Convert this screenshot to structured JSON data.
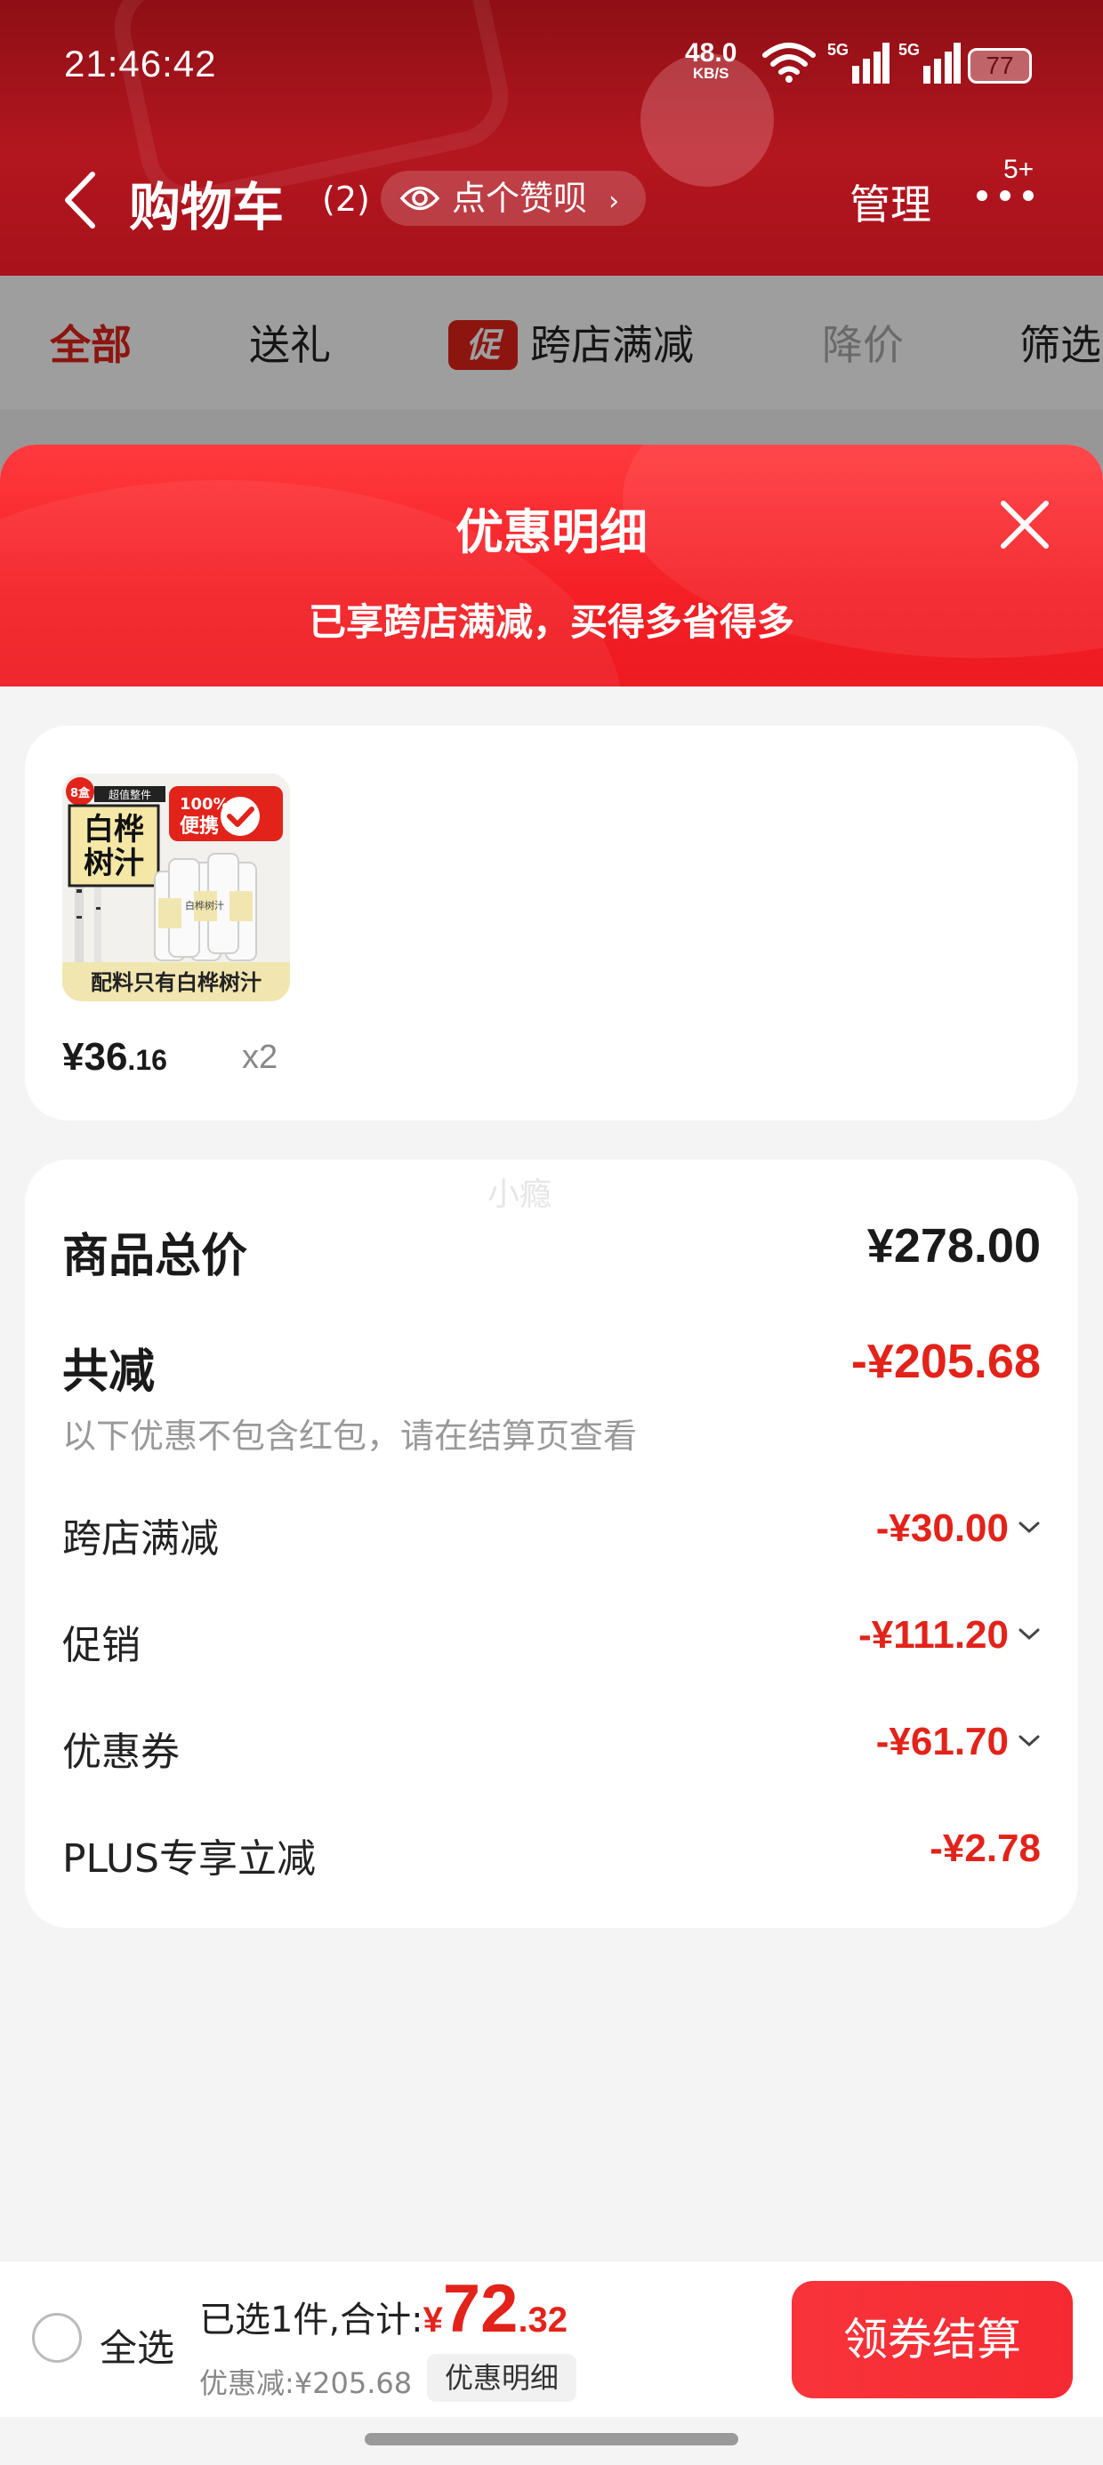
{
  "status_bar": {
    "time": "21:46:42",
    "net_speed": "48.0",
    "net_unit": "KB/S",
    "sig1_label": "5G",
    "sig2_label": "5G",
    "battery": "77"
  },
  "nav": {
    "title": "购物车",
    "count": "(2)",
    "like_label": "点个赞呗",
    "manage": "管理",
    "badge": "5+"
  },
  "tabs": [
    {
      "label": "全部",
      "state": "active"
    },
    {
      "label": "送礼",
      "state": "normal"
    },
    {
      "label": "跨店满减",
      "badge": "促",
      "state": "normal"
    },
    {
      "label": "降价",
      "state": "disabled"
    },
    {
      "label": "筛选",
      "state": "normal"
    }
  ],
  "sheet": {
    "title": "优惠明细",
    "subtitle": "已享跨店满减，买得多省得多"
  },
  "product": {
    "price_int": "¥36",
    "price_dec": ".16",
    "qty": "x2",
    "thumb": {
      "badge": "8盒",
      "brand": "超值整件",
      "name_line1": "白桦",
      "name_line2": "树汁",
      "tag_line1": "100%",
      "tag_line2": "便携",
      "bottle_label": "白桦树汁",
      "caption": "配料只有白桦树汁"
    }
  },
  "summary": {
    "watermark": "小瘾",
    "total_label": "商品总价",
    "total_value": "¥278.00",
    "reduce_label": "共减",
    "reduce_value": "-¥205.68",
    "reduce_note": "以下优惠不包含红包，请在结算页查看",
    "items": [
      {
        "label": "跨店满减",
        "value": "-¥30.00",
        "expand": true
      },
      {
        "label": "促销",
        "value": "-¥111.20",
        "expand": true
      },
      {
        "label": "优惠券",
        "value": "-¥61.70",
        "expand": true
      },
      {
        "label": "PLUS专享立减",
        "value": "-¥2.78",
        "expand": false
      }
    ]
  },
  "bottom_bar": {
    "select_all": "全选",
    "selected_text": "已选1件,合计:",
    "total_currency": "¥",
    "total_int": "72",
    "total_dec": ".32",
    "saved_text": "优惠减:¥205.68",
    "detail_button": "优惠明细",
    "checkout_button": "领券结算"
  },
  "colors": {
    "accent_red": "#e2231a",
    "header_dark_red": "#a8121b",
    "sheet_red": "#f42026"
  }
}
